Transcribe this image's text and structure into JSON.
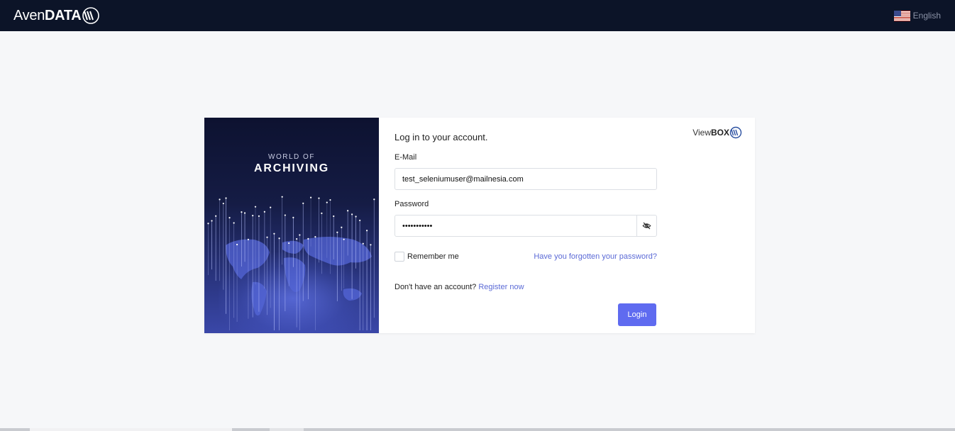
{
  "header": {
    "logo_light": "Aven",
    "logo_bold": "DATA",
    "logo_icon": "avendata-waves-icon",
    "language": {
      "label": "English",
      "flag": "us-flag-icon"
    }
  },
  "hero": {
    "subtitle": "WORLD OF",
    "title": "ARCHIVING"
  },
  "login": {
    "title": "Log in to your account.",
    "brand_light": "View",
    "brand_bold": "BOX",
    "email_label": "E-Mail",
    "email_value": "test_seleniumuser@mailnesia.com",
    "password_label": "Password",
    "password_value": "•••••••••••",
    "toggle_icon": "eye-slash-icon",
    "remember_label": "Remember me",
    "remember_checked": false,
    "forgot_link": "Have you forgotten your password?",
    "no_account_text": "Don't have an account?",
    "register_link": "Register now",
    "login_button": "Login"
  },
  "colors": {
    "topbar": "#0c1428",
    "accent": "#5f6bf0",
    "link": "#5b6ad6",
    "page_bg": "#f6f7f9"
  }
}
